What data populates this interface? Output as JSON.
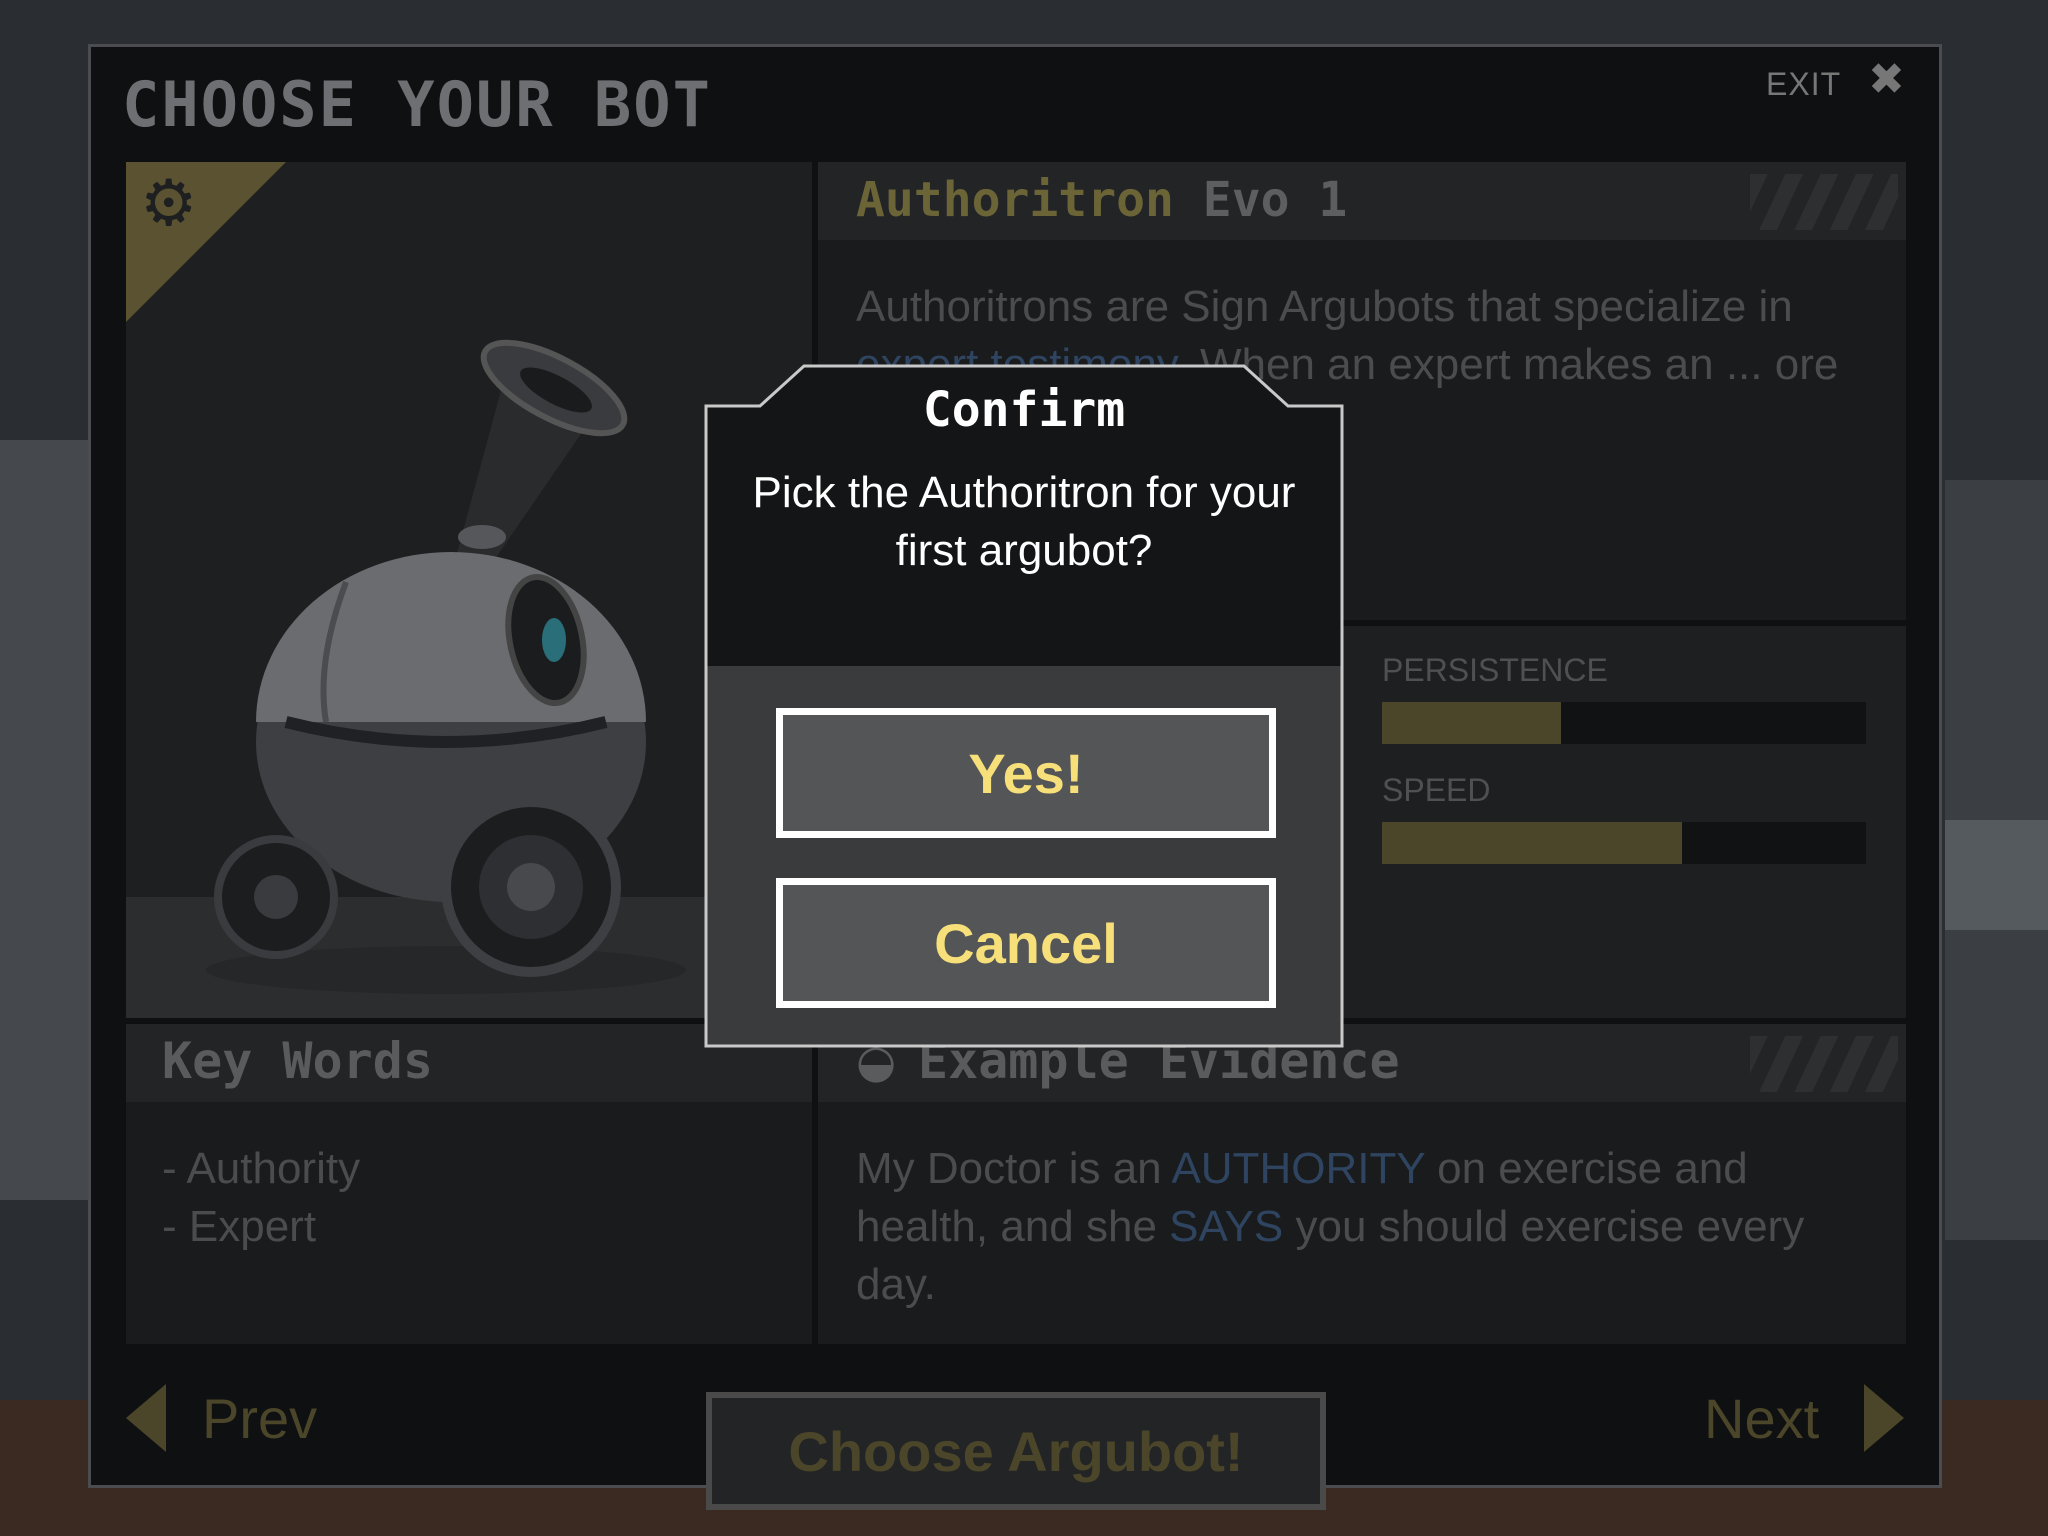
{
  "header": {
    "title": "CHOOSE YOUR BOT",
    "exit_label": "EXIT",
    "exit_icon": "close-icon"
  },
  "bot": {
    "name_part1": "Authoritron",
    "name_part2": "Evo 1",
    "description_pre": "Authoritrons are Sign Argubots that specialize in ",
    "description_link": "expert testimony",
    "description_post": ". When an expert makes an ... ore weight if their"
  },
  "stats": [
    {
      "label": "PERSISTENCE",
      "value": 0.37
    },
    {
      "label": "SPEED",
      "value": 0.62
    }
  ],
  "keywords": {
    "title": "Key Words",
    "items": [
      "- Authority",
      "- Expert"
    ]
  },
  "evidence": {
    "title": "Example Evidence",
    "text_1": "My Doctor is an ",
    "hl_1": "AUTHORITY",
    "text_2": " on exercise and health, and she ",
    "hl_2": "SAYS",
    "text_3": " you should exercise every day."
  },
  "nav": {
    "prev_label": "Prev",
    "next_label": "Next",
    "choose_label": "Choose Argubot!"
  },
  "modal": {
    "title": "Confirm",
    "message": "Pick the Authoritron for your first argubot?",
    "yes_label": "Yes!",
    "cancel_label": "Cancel"
  },
  "colors": {
    "accent_yellow": "#f7e07a",
    "olive": "#6b6437",
    "highlight_blue": "#2e4460"
  }
}
